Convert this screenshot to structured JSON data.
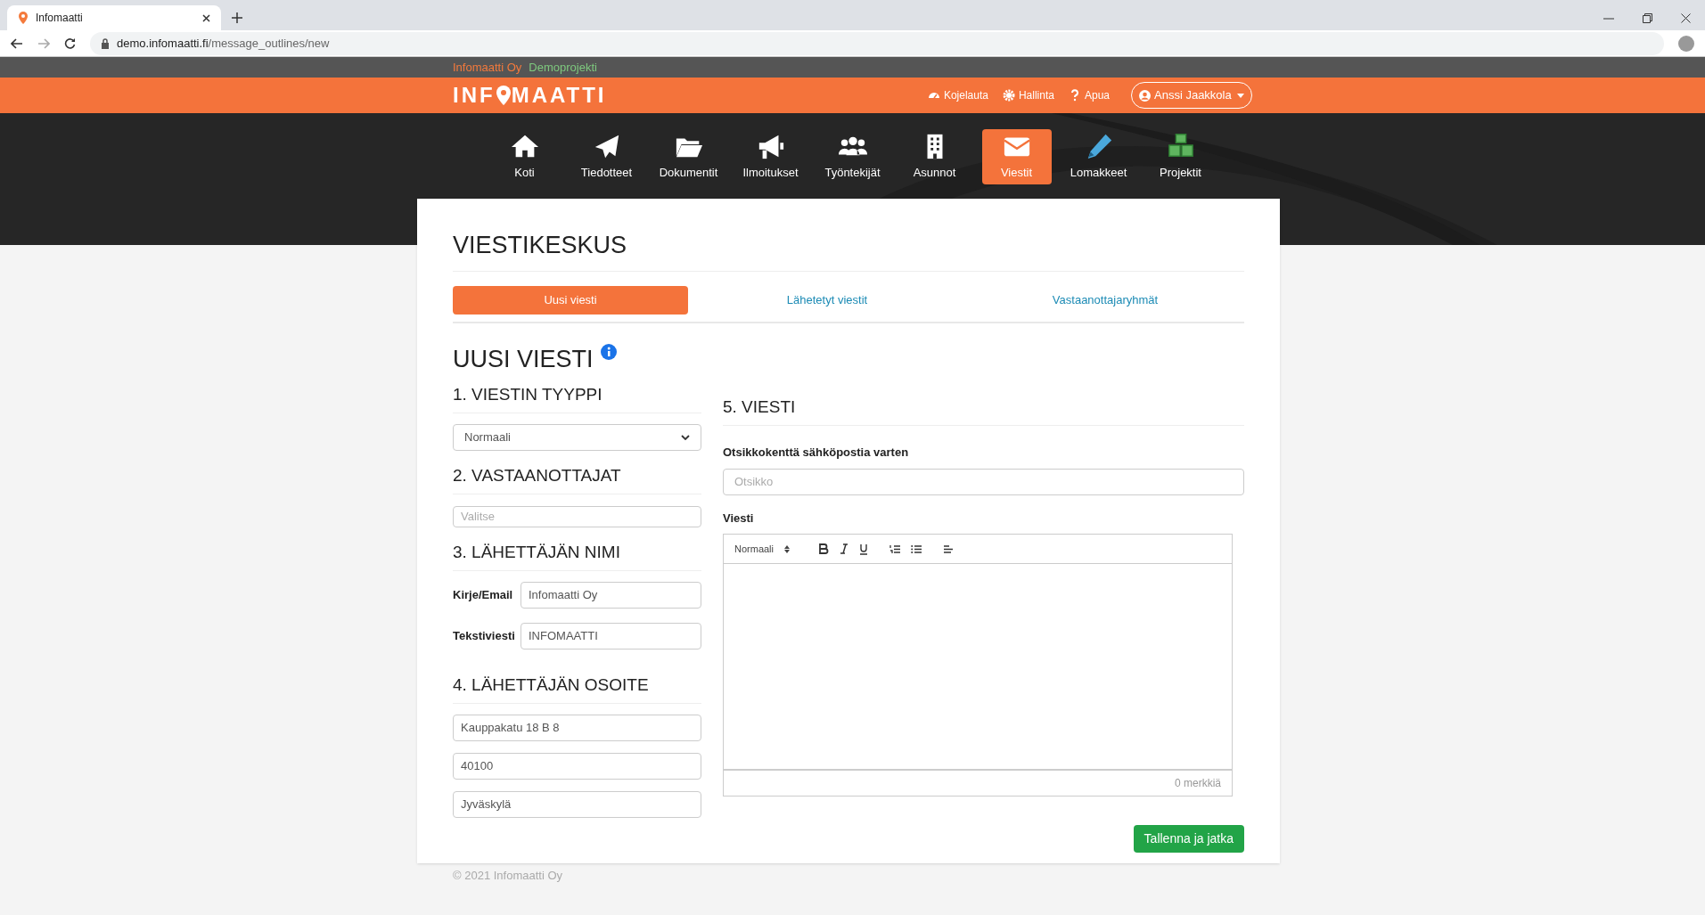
{
  "browser": {
    "tab_title": "Infomaatti",
    "url_domain": "demo.infomaatti.fi",
    "url_path": "/message_outlines/new"
  },
  "topbar": {
    "organization": "Infomaatti Oy",
    "project": "Demoprojekti"
  },
  "header": {
    "logo_start": "INF",
    "logo_end": "MAATTI",
    "links": [
      {
        "label": "Kojelauta"
      },
      {
        "label": "Hallinta"
      },
      {
        "label": "Apua"
      }
    ],
    "user": "Anssi Jaakkola"
  },
  "nav": [
    {
      "label": "Koti",
      "selected": false
    },
    {
      "label": "Tiedotteet",
      "selected": false
    },
    {
      "label": "Dokumentit",
      "selected": false
    },
    {
      "label": "Ilmoitukset",
      "selected": false
    },
    {
      "label": "Työntekijät",
      "selected": false
    },
    {
      "label": "Asunnot",
      "selected": false
    },
    {
      "label": "Viestit",
      "selected": true
    },
    {
      "label": "Lomakkeet",
      "selected": false
    },
    {
      "label": "Projektit",
      "selected": false
    }
  ],
  "page_title": "VIESTIKESKUS",
  "tabs": [
    {
      "label": "Uusi viesti",
      "selected": true
    },
    {
      "label": "Lähetetyt viestit",
      "selected": false
    },
    {
      "label": "Vastaanottajaryhmät",
      "selected": false
    }
  ],
  "form_title": "UUSI VIESTI",
  "type_section": {
    "heading": "1. VIESTIN TYYPPI",
    "value": "Normaali"
  },
  "recipients_section": {
    "heading": "2. VASTAANOTTAJAT",
    "placeholder": "Valitse"
  },
  "sender_section": {
    "heading": "3. LÄHETTÄJÄN NIMI",
    "fields": [
      {
        "label": "Kirje/Email",
        "value": "Infomaatti Oy"
      },
      {
        "label": "Tekstiviesti",
        "value": "INFOMAATTI"
      }
    ]
  },
  "address_section": {
    "heading": "4. LÄHETTÄJÄN OSOITE",
    "fields": [
      "Kauppakatu 18 B 8",
      "40100",
      "Jyväskylä"
    ]
  },
  "message_section": {
    "heading": "5. VIESTI",
    "subject_label": "Otsikkokenttä sähköpostia varten",
    "subject_placeholder": "Otsikko",
    "body_label": "Viesti",
    "format": "Normaali",
    "counter": "0 merkkiä"
  },
  "save_button": "Tallenna ja jatka",
  "footer": "© 2021 Infomaatti Oy"
}
